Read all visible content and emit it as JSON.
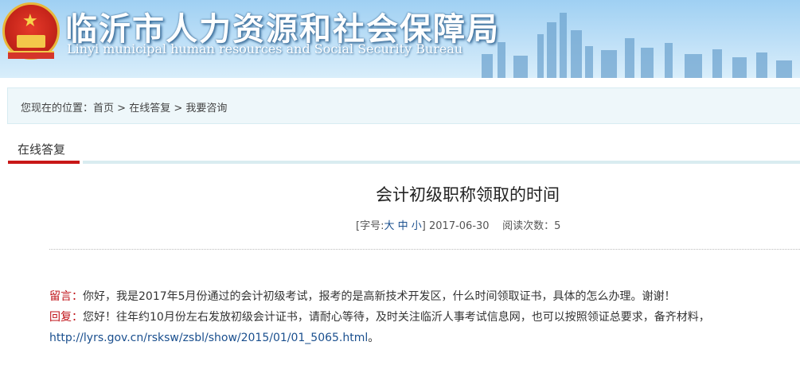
{
  "header": {
    "title": "临沂市人力资源和社会保障局",
    "subtitle": "Linyi municipal human resources and Social Security Bureau",
    "emblem_icon": "national-emblem-icon",
    "brand_color": "#c8261b"
  },
  "breadcrumb": {
    "prefix": "您现在的位置：",
    "items": [
      "首页",
      "在线答复",
      "我要咨询"
    ],
    "separator": ">"
  },
  "tab": {
    "label": "在线答复",
    "accent_color": "#c81717"
  },
  "article": {
    "title": "会计初级职称领取的时间",
    "font_size_label": "[字号:",
    "font_sizes": [
      "大",
      "中",
      "小"
    ],
    "font_size_close": "]",
    "date": "2017-06-30",
    "read_count_label": "阅读次数：",
    "read_count": "5"
  },
  "message": {
    "label": "留言",
    "colon": "：",
    "text": "你好，我是2017年5月份通过的会计初级考试，报考的是高新技术开发区，什么时间领取证书，具体的怎么办理。谢谢！"
  },
  "reply": {
    "label": "回复",
    "colon": "：",
    "text": "您好！往年约10月份左右发放初级会计证书，请耐心等待，及时关注临沂人事考试信息网，也可以按照领证总要求，备齐材料，",
    "link": "http://lyrs.gov.cn/rsksw/zsbl/show/2015/01/01_5065.html",
    "end": "。"
  }
}
